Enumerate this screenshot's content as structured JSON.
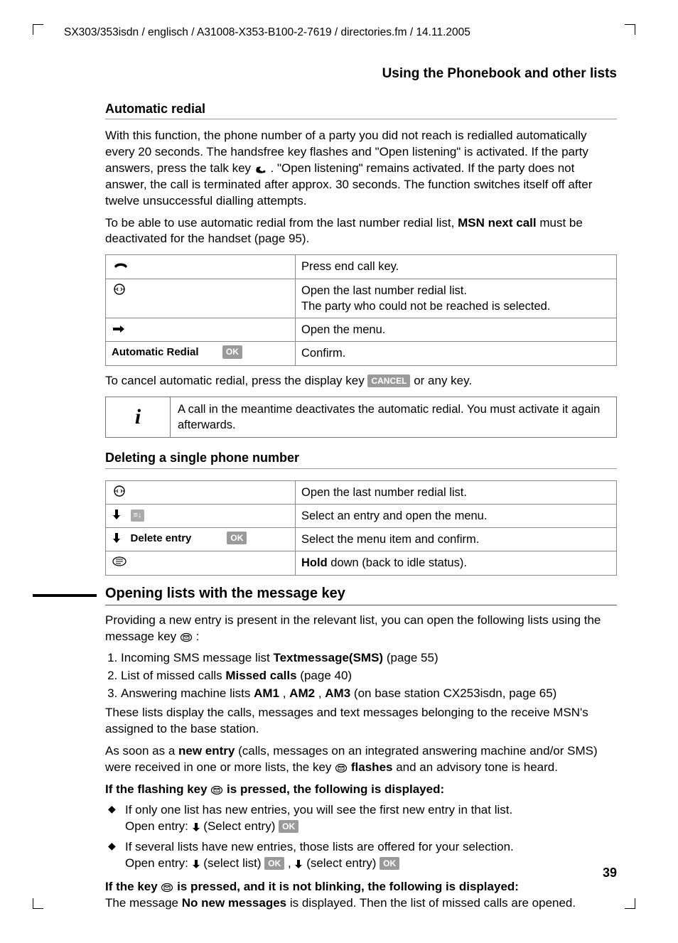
{
  "header_path": "SX303/353isdn / englisch / A31008-X353-B100-2-7619 / directories.fm / 14.11.2005",
  "section_title": "Using the Phonebook and other lists",
  "auto_redial": {
    "heading": "Automatic redial",
    "p1a": "With this function, the phone number of a party you did not reach is redialled automatically every 20 seconds. The handsfree key flashes and \"Open listening\" is activated. If the party answers, press the talk key ",
    "p1b": ". \"Open listening\" remains activated. If the party does not answer, the call is terminated after approx. 30 seconds. The function switches itself off after twelve unsuccessful dialling attempts.",
    "p2a": "To be able to use automatic redial from the last number redial list, ",
    "p2b": "MSN next call",
    "p2c": " must be deactivated for the handset (page 95).",
    "table": [
      {
        "left_type": "end-call",
        "right": "Press end call key."
      },
      {
        "left_type": "redial",
        "right": "Open the last number redial list.\nThe party who could not be reached is selected."
      },
      {
        "left_type": "arrow-right",
        "right": "Open the menu."
      },
      {
        "left_type": "label-ok",
        "label": "Automatic Redial",
        "right": "Confirm."
      }
    ],
    "cancel_a": "To cancel automatic redial, press the display key ",
    "cancel_btn": "CANCEL",
    "cancel_b": " or any key.",
    "info": "A call in the meantime deactivates the automatic redial. You must activate it again afterwards."
  },
  "delete_single": {
    "heading": "Deleting a single phone number",
    "table": [
      {
        "left_type": "redial",
        "right": "Open the last number redial list."
      },
      {
        "left_type": "down-menu",
        "right": "Select an entry and open the menu."
      },
      {
        "left_type": "down-label-ok",
        "label": "Delete entry",
        "right": "Select the menu item and confirm."
      },
      {
        "left_type": "hold-icon",
        "right_a": "Hold",
        "right_b": " down (back to idle status)."
      }
    ]
  },
  "opening_lists": {
    "heading": "Opening lists with the message key",
    "intro_a": "Providing a new entry is present in the relevant list, you can open the following lists using the message key ",
    "intro_b": ":",
    "items": [
      {
        "a": "Incoming SMS message list ",
        "b": "Textmessage(SMS)",
        "c": " (page 55)"
      },
      {
        "a": "List of missed calls ",
        "b": "Missed calls",
        "c": " (page 40)"
      },
      {
        "a": "Answering machine lists ",
        "b": "AM1",
        "sep1": ", ",
        "b2": "AM2",
        "sep2": ", ",
        "b3": "AM3",
        "c": " (on base station CX253isdn, page 65)"
      }
    ],
    "p2": "These lists display the calls, messages and text messages belonging to the receive MSN's assigned to the base station.",
    "p3a": "As soon as a ",
    "p3b": "new entry",
    "p3c": " (calls, messages on an integrated answering machine and/or SMS) were received in one or more lists, the key ",
    "p3d": " flashes",
    "p3e": " and an advisory tone is heard.",
    "cond1_a": "If the flashing key ",
    "cond1_b": " is pressed, the following is displayed:",
    "bullets": [
      {
        "line1": "If only one list has new entries, you will see the first new entry in that list.",
        "line2a": "Open entry:  ",
        "line2b": "  (Select entry) "
      },
      {
        "line1": "If several lists have new entries, those lists are offered for your selection.",
        "line2a": "Open entry:  ",
        "line2b": "  (select list) ",
        "line2c": ",  ",
        "line2d": "  (select entry) "
      }
    ],
    "cond2_a": "If the key ",
    "cond2_b": " is pressed, and it is not blinking, the following is displayed:",
    "cond2_line2a": "The message ",
    "cond2_line2b": "No new messages",
    "cond2_line2c": " is displayed. Then the list of missed calls are opened."
  },
  "ok_label": "OK",
  "page_number": "39"
}
